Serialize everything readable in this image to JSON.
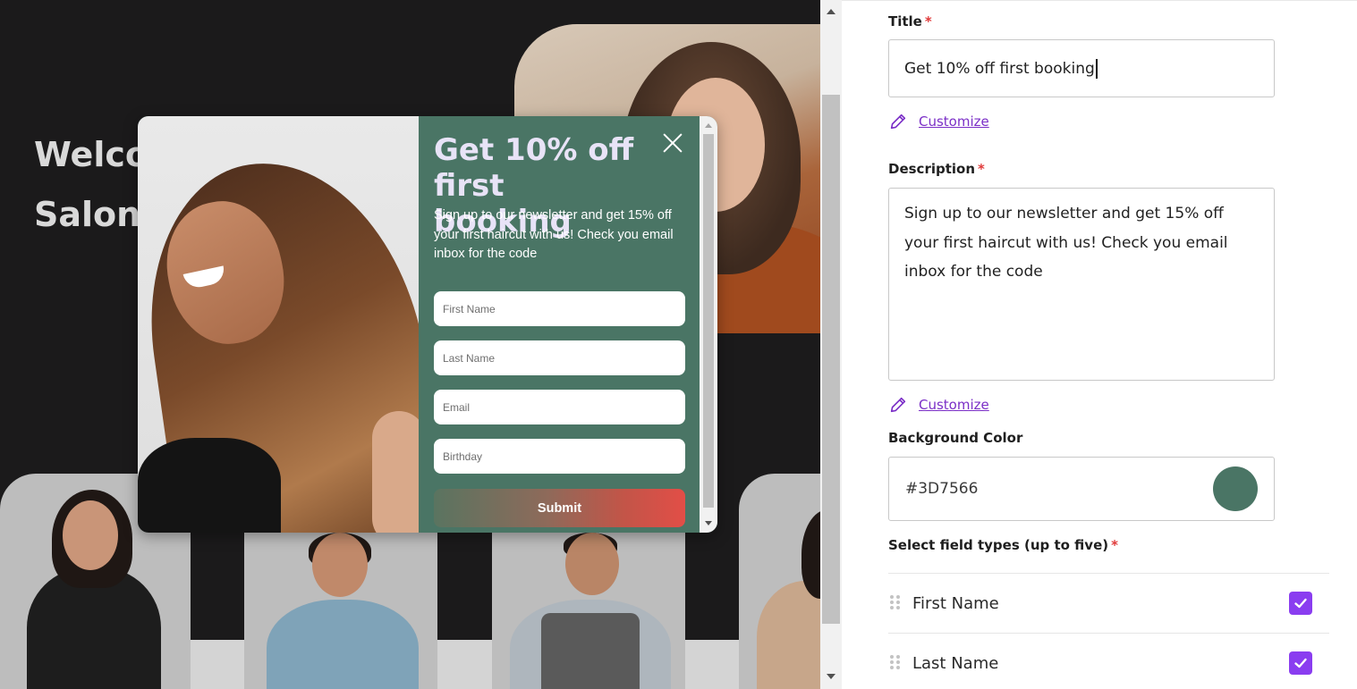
{
  "preview": {
    "hero_line1": "Welco",
    "hero_line2": "Salon"
  },
  "popup": {
    "title": "Get 10% off first booking",
    "description": "Sign up to our newsletter and get 15% off your first haircut with us! Check you email inbox for the code",
    "fields": [
      {
        "placeholder": "First Name"
      },
      {
        "placeholder": "Last Name"
      },
      {
        "placeholder": "Email"
      },
      {
        "placeholder": "Birthday"
      }
    ],
    "submit_label": "Submit",
    "icons": {
      "close": "close-icon"
    },
    "colors": {
      "background": "#3D7566",
      "submit_gradient_end": "#E24E47"
    }
  },
  "panel": {
    "title_label": "Title",
    "title_value": "Get 10% off first booking",
    "customize_label": "Customize",
    "description_label": "Description",
    "description_value": "Sign up to our newsletter and get 15% off your first haircut with us! Check you email inbox for the code",
    "background_label": "Background Color",
    "background_value": "#3D7566",
    "required_marker": "*",
    "field_types_label": "Select field types (up to five)",
    "field_types": [
      {
        "label": "First Name",
        "checked": true
      },
      {
        "label": "Last Name",
        "checked": true
      }
    ],
    "icons": {
      "customize": "pencil-icon",
      "drag": "drag-handle-icon",
      "check": "check-icon"
    },
    "colors": {
      "link": "#7B2FC7",
      "checkbox": "#8A3DF0",
      "required": "#E03A3A"
    }
  }
}
